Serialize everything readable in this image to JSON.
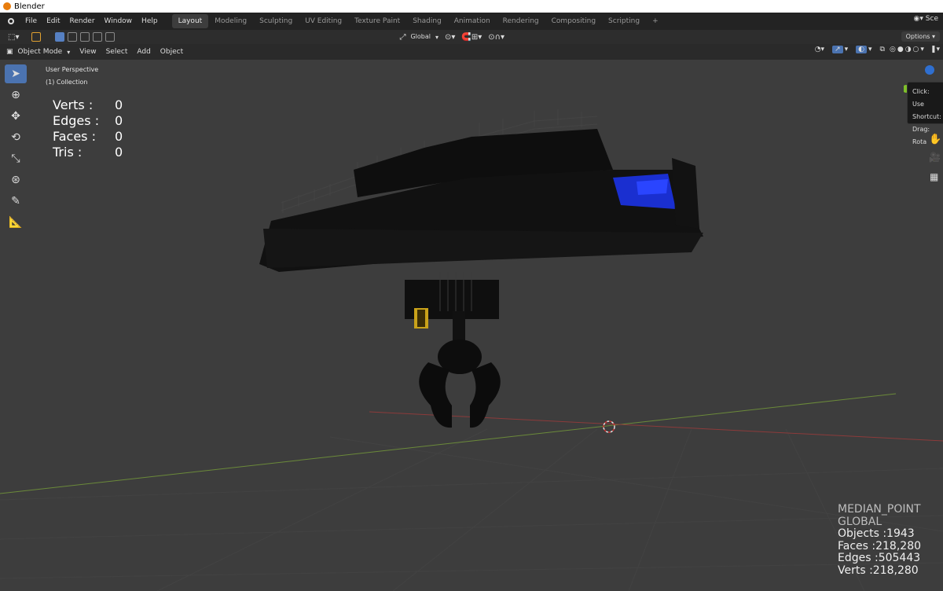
{
  "window": {
    "title": "Blender"
  },
  "menu": [
    "File",
    "Edit",
    "Render",
    "Window",
    "Help"
  ],
  "workspaces": [
    {
      "label": "Layout",
      "active": true
    },
    {
      "label": "Modeling",
      "active": false
    },
    {
      "label": "Sculpting",
      "active": false
    },
    {
      "label": "UV Editing",
      "active": false
    },
    {
      "label": "Texture Paint",
      "active": false
    },
    {
      "label": "Shading",
      "active": false
    },
    {
      "label": "Animation",
      "active": false
    },
    {
      "label": "Rendering",
      "active": false
    },
    {
      "label": "Compositing",
      "active": false
    },
    {
      "label": "Scripting",
      "active": false
    }
  ],
  "add_workspace": "+",
  "scene_label": "Sce",
  "toolheader": {
    "transform_orientation": "Global",
    "options": "Options"
  },
  "view_header": {
    "mode": "Object Mode",
    "menus": [
      "View",
      "Select",
      "Add",
      "Object"
    ]
  },
  "viewport_info": {
    "perspective": "User Perspective",
    "collection": "(1) Collection"
  },
  "stats": [
    {
      "label": "Verts :",
      "value": "0"
    },
    {
      "label": "Edges :",
      "value": "0"
    },
    {
      "label": "Faces :",
      "value": "0"
    },
    {
      "label": "Tris :",
      "value": "0"
    }
  ],
  "stats_br": [
    "MEDIAN_POINT",
    "GLOBAL",
    "Objects :1943",
    "Faces :218,280",
    "Edges :505443",
    "Verts :218,280"
  ],
  "tooltip": {
    "line1": "Click: Use",
    "line2": "Shortcut:",
    "line3": "Drag: Rota"
  },
  "colors": {
    "accent": "#4b73b0",
    "axis_x": "#8c3b3b",
    "axis_y": "#6b8a3a",
    "model": "#151515",
    "model_blue": "#1a2fd0",
    "model_yellow": "#c9a21a"
  }
}
